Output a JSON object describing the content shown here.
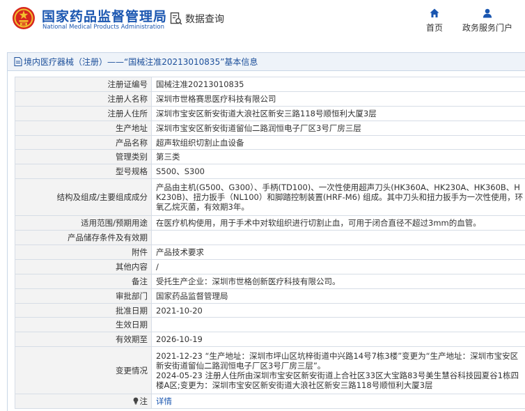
{
  "header": {
    "brand_cn": "国家药品监督管理局",
    "brand_en": "National Medical Products Administration",
    "query_label": "数据查询",
    "nav": [
      {
        "label": "首页",
        "icon": "home-icon"
      },
      {
        "label": "政务服务门户",
        "icon": "user-icon"
      }
    ]
  },
  "panel": {
    "title": "境内医疗器械（注册）——“国械注准20213010835”基本信息",
    "icon": "document-icon"
  },
  "rows": [
    {
      "label": "注册证编号",
      "value": "国械注准20213010835"
    },
    {
      "label": "注册人名称",
      "value": "深圳市世格赛思医疗科技有限公司"
    },
    {
      "label": "注册人住所",
      "value": "深圳市宝安区新安街道大浪社区新安三路118号顺恒利大厦3层"
    },
    {
      "label": "生产地址",
      "value": "深圳市宝安区新安街道留仙二路润恒电子厂区3号厂房三层"
    },
    {
      "label": "产品名称",
      "value": "超声软组织切割止血设备"
    },
    {
      "label": "管理类别",
      "value": "第三类"
    },
    {
      "label": "型号规格",
      "value": "S500、S300"
    },
    {
      "label": "结构及组成/主要组成成分",
      "value": "产品由主机(G500、G300）、手柄(TD100)、一次性使用超声刀头(HK360A、HK230A、HK360B、HK230B)、扭力扳手（NL100）和脚踏控制装置(HRF-M6) 组成。其中刀头和扭力扳手为一次性使用，环氧乙烷灭菌，有效期3年。"
    },
    {
      "label": "适用范围/预期用途",
      "value": "在医疗机构使用，用于手术中对软组织进行切割止血，可用于闭合直径不超过3mm的血管。"
    },
    {
      "label": "产品储存条件及有效期",
      "value": ""
    },
    {
      "label": "附件",
      "value": "产品技术要求"
    },
    {
      "label": "其他内容",
      "value": "/"
    },
    {
      "label": "备注",
      "value": "受托生产企业：深圳市世格创新医疗科技有限公司。"
    },
    {
      "label": "审批部门",
      "value": "国家药品监督管理局"
    },
    {
      "label": "批准日期",
      "value": "2021-10-20"
    },
    {
      "label": "生效日期",
      "value": ""
    },
    {
      "label": "有效期至",
      "value": "2026-10-19"
    },
    {
      "label": "变更情况",
      "value": "2021-12-23 “生产地址：深圳市坪山区坑梓街道中兴路14号7栋3楼”变更为“生产地址：深圳市宝安区新安街道留仙二路润恒电子厂区3号厂房三层”。\n2024-05-23 注册人住所由深圳市宝安区新安街道上合社区33区大宝路83号美生慧谷科技园夏谷1栋四楼A区;变更为：深圳市宝安区新安街道大浪社区新安三路118号顺恒利大厦3层"
    },
    {
      "label": "注",
      "value": "详情",
      "icon": "lightbulb-icon"
    }
  ],
  "colors": {
    "brand_blue": "#1a56b0",
    "emblem_red": "#d7261e",
    "emblem_gold": "#f2c12e",
    "label_bg": "#f3f3f3",
    "head_bg": "#eef3f9"
  }
}
